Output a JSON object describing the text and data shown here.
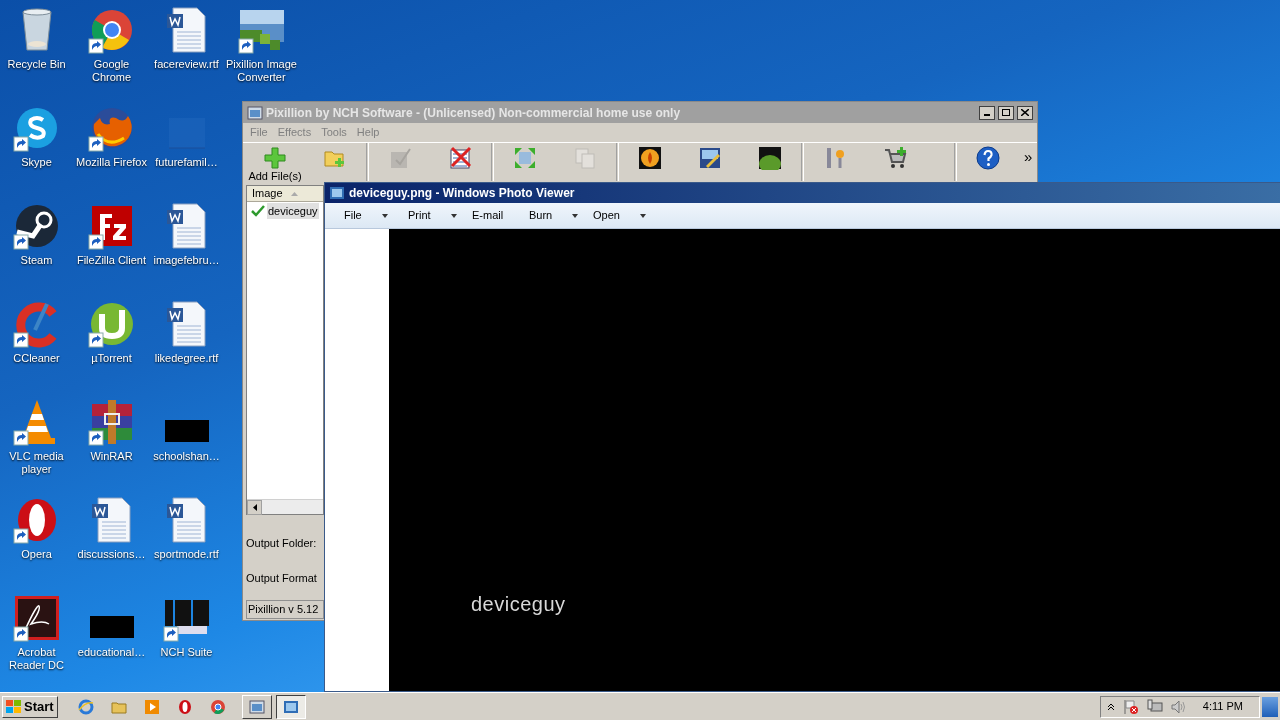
{
  "desktop_rows": [
    [
      {
        "label": "Recycle Bin",
        "kind": "bin",
        "shortcut": false
      },
      {
        "label": "Google Chrome",
        "kind": "chrome",
        "shortcut": true
      },
      {
        "label": "facereview.rtf",
        "kind": "word",
        "shortcut": false
      },
      {
        "label": "Pixillion Image Converter",
        "kind": "pixillion",
        "shortcut": true
      }
    ],
    [
      {
        "label": "Skype",
        "kind": "skype",
        "shortcut": true
      },
      {
        "label": "Mozilla Firefox",
        "kind": "firefox",
        "shortcut": true
      },
      {
        "label": "futurefamil…",
        "kind": "blank",
        "shortcut": false
      }
    ],
    [
      {
        "label": "Steam",
        "kind": "steam",
        "shortcut": true
      },
      {
        "label": "FileZilla Client",
        "kind": "filezilla",
        "shortcut": true
      },
      {
        "label": "imagefebru…",
        "kind": "word",
        "shortcut": false
      }
    ],
    [
      {
        "label": "CCleaner",
        "kind": "ccleaner",
        "shortcut": true
      },
      {
        "label": "µTorrent",
        "kind": "utorrent",
        "shortcut": true
      },
      {
        "label": "likedegree.rtf",
        "kind": "word",
        "shortcut": false
      }
    ],
    [
      {
        "label": "VLC media player",
        "kind": "vlc",
        "shortcut": true
      },
      {
        "label": "WinRAR",
        "kind": "winrar",
        "shortcut": true
      },
      {
        "label": "schoolshan…",
        "kind": "black",
        "shortcut": false
      }
    ],
    [
      {
        "label": "Opera",
        "kind": "opera",
        "shortcut": true
      },
      {
        "label": "discussions…",
        "kind": "word",
        "shortcut": false
      },
      {
        "label": "sportmode.rtf",
        "kind": "word",
        "shortcut": false
      }
    ],
    [
      {
        "label": "Acrobat Reader DC",
        "kind": "acrobat",
        "shortcut": true
      },
      {
        "label": "educational…",
        "kind": "black",
        "shortcut": false
      },
      {
        "label": "NCH Suite",
        "kind": "nch",
        "shortcut": true
      }
    ]
  ],
  "pixillion": {
    "title": "Pixillion by NCH Software - (Unlicensed) Non-commercial home use only",
    "active": false,
    "menu": [
      "File",
      "Effects",
      "Tools",
      "Help"
    ],
    "toolbar": [
      {
        "label": "Add File(s)",
        "kind": "add",
        "disabled": false,
        "separator_before": false
      },
      {
        "kind": "folder",
        "disabled": false,
        "separator_before": false
      },
      {
        "kind": "select",
        "disabled": true,
        "separator_before": true
      },
      {
        "kind": "remove",
        "disabled": false,
        "separator_before": false
      },
      {
        "kind": "resize",
        "disabled": false,
        "separator_before": true
      },
      {
        "kind": "combine",
        "disabled": true,
        "separator_before": false
      },
      {
        "kind": "burn",
        "disabled": false,
        "separator_before": true
      },
      {
        "kind": "edit",
        "disabled": false,
        "separator_before": false
      },
      {
        "kind": "slideshow",
        "disabled": false,
        "separator_before": false
      },
      {
        "kind": "options",
        "disabled": false,
        "separator_before": true
      },
      {
        "kind": "cart",
        "disabled": false,
        "separator_before": false
      },
      {
        "kind": "help",
        "disabled": false,
        "separator_before": true,
        "spaced": true
      }
    ],
    "overflow": "»",
    "list_header": "Image",
    "files": [
      {
        "name": "deviceguy",
        "checked": true,
        "selected": true
      }
    ],
    "output_folder_label": "Output Folder:",
    "output_format_label": "Output Format",
    "status": "Pixillion v 5.12"
  },
  "photo_viewer": {
    "title": "deviceguy.png - Windows Photo Viewer",
    "active": true,
    "menu": [
      {
        "label": "File",
        "dropdown": true
      },
      {
        "label": "Print",
        "dropdown": true
      },
      {
        "label": "E-mail",
        "dropdown": false
      },
      {
        "label": "Burn",
        "dropdown": true
      },
      {
        "label": "Open",
        "dropdown": true
      }
    ],
    "image_caption": "deviceguy"
  },
  "taskbar": {
    "start": "Start",
    "quick_launch": [
      {
        "kind": "ie"
      },
      {
        "kind": "explorer"
      },
      {
        "kind": "media"
      },
      {
        "kind": "opera"
      },
      {
        "kind": "chrome"
      }
    ],
    "tasks": [
      {
        "kind": "pixillion",
        "pressed": false
      },
      {
        "kind": "photo",
        "pressed": true
      }
    ],
    "clock": "4:11 PM"
  }
}
